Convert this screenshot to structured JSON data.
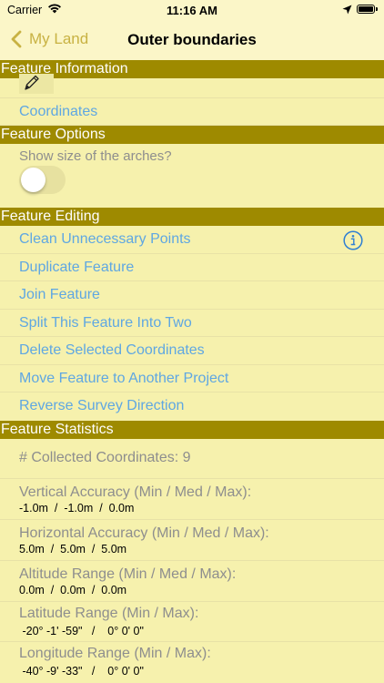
{
  "status_bar": {
    "carrier": "Carrier",
    "time": "11:16 AM"
  },
  "nav": {
    "back_label": "My Land",
    "title": "Outer boundaries"
  },
  "colors": {
    "accent": "#c8b243",
    "link": "#5fa7e2",
    "section": "#9e8a00",
    "background": "#f6f1ad"
  },
  "feature_information": {
    "header": "Feature Information",
    "icon": "pencil-icon",
    "coordinates_link": "Coordinates"
  },
  "feature_options": {
    "header": "Feature Options",
    "arches_label": "Show size of the arches?",
    "arches_toggle_on": false
  },
  "feature_editing": {
    "header": "Feature Editing",
    "items": [
      "Clean Unnecessary Points",
      "Duplicate Feature",
      "Join Feature",
      "Split This Feature Into Two",
      "Delete Selected Coordinates",
      "Move Feature to Another Project",
      "Reverse Survey Direction"
    ]
  },
  "feature_statistics": {
    "header": "Feature Statistics",
    "collected": "# Collected Coordinates: 9",
    "vertical_label": "Vertical Accuracy (Min / Med / Max):",
    "vertical_value": "-1.0m  /  -1.0m  /  0.0m",
    "horizontal_label": "Horizontal Accuracy (Min / Med / Max):",
    "horizontal_value": "5.0m  /  5.0m  /  5.0m",
    "altitude_label": "Altitude Range (Min / Med / Max):",
    "altitude_value": "0.0m  /  0.0m  /  0.0m",
    "latitude_label": "Latitude Range (Min / Max):",
    "latitude_value": " -20° -1' -59\"   /    0° 0' 0\"",
    "longitude_label": "Longitude Range (Min / Max):",
    "longitude_value": " -40° -9' -33\"   /    0° 0' 0\""
  }
}
